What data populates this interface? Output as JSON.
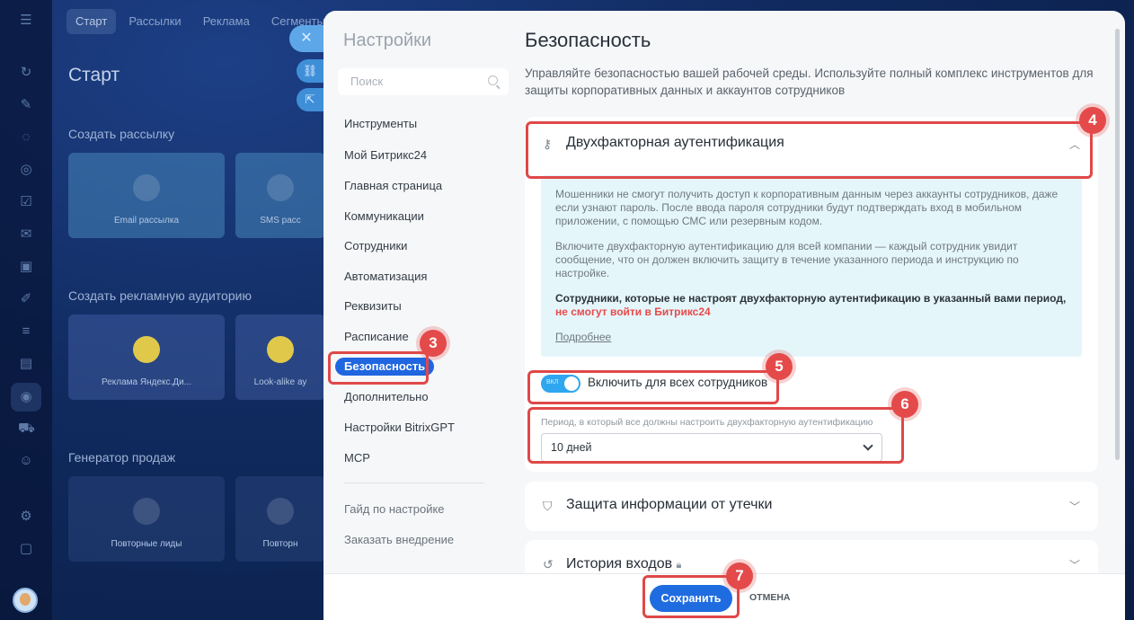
{
  "background": {
    "topnav": [
      "Старт",
      "Рассылки",
      "Реклама",
      "Сегменты"
    ],
    "page_title": "Старт",
    "section_mailing": "Создать рассылку",
    "card_email": "Email рассылка",
    "card_sms": "SMS расс",
    "section_ads": "Создать рекламную аудиторию",
    "card_yandex": "Реклама Яндекс.Ди...",
    "card_lookalike": "Look-alike ау",
    "section_sales": "Генератор продаж",
    "card_sales1": "Повторные лиды",
    "card_sales2": "Повторн"
  },
  "nav": {
    "title": "Настройки",
    "search_placeholder": "Поиск",
    "items": [
      "Инструменты",
      "Мой Битрикс24",
      "Главная страница",
      "Коммуникации",
      "Сотрудники",
      "Автоматизация",
      "Реквизиты",
      "Расписание",
      "Безопасность",
      "Дополнительно",
      "Настройки BitrixGPT",
      "MCP"
    ],
    "footer_links": [
      "Гайд по настройке",
      "Заказать внедрение"
    ]
  },
  "content": {
    "title": "Безопасность",
    "description": "Управляйте безопасностью вашей рабочей среды. Используйте полный комплекс инструментов для защиты корпоративных данных и аккаунтов сотрудников",
    "tfa": {
      "title": "Двухфакторная аутентификация",
      "info_p1": "Мошенники не смогут получить доступ к корпоративным данным через аккаунты сотрудников, даже если узнают пароль. После ввода пароля сотрудники будут подтверждать вход в мобильном приложении, с помощью СМС или резервным кодом.",
      "info_p2": "Включите двухфакторную аутентификацию для всей компании — каждый сотрудник увидит сообщение, что он должен включить защиту в течение указанного периода и инструкцию по настройке.",
      "info_p3_bold": "Сотрудники, которые не настроят двухфакторную аутентификацию в указанный вами период,",
      "info_p3_red": "не смогут войти в Битрикс24",
      "more_link": "Подробнее",
      "toggle_text": "ВКЛ",
      "toggle_label": "Включить для всех сотрудников",
      "period_label": "Период, в который все должны настроить двухфакторную аутентификацию",
      "period_value": "10 дней"
    },
    "leak": {
      "title": "Защита информации от утечки"
    },
    "history": {
      "title": "История входов"
    }
  },
  "footer": {
    "save_label": "Сохранить",
    "cancel_label": "ОТМЕНА"
  },
  "callouts": [
    "3",
    "4",
    "5",
    "6",
    "7"
  ],
  "colors": {
    "accent": "#1f6ce0",
    "callout": "#e04848",
    "info_bg": "#e5f6fb",
    "toggle": "#2fa6f0"
  }
}
